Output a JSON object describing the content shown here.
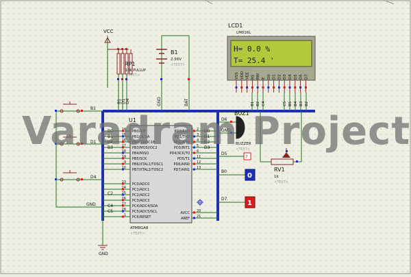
{
  "colors": {
    "bus": "#1f2fb0",
    "wire": "#1a7a1a",
    "component": "#8a2424",
    "chip_fill": "#d8d8d8",
    "lcd_screen": "#b4c83c",
    "watermark": "#6e6e6e",
    "pin_red": "#d81b1b",
    "pin_blue": "#1c2fd6"
  },
  "watermark": "Varadram Projects",
  "vcc": {
    "label": "VCC"
  },
  "gnd": {
    "label": "GND"
  },
  "resistor_pack": {
    "ref": "RP1",
    "value": "10K PULLUP",
    "text": "<TEXT>"
  },
  "battery": {
    "ref": "B1",
    "value": "2.56V",
    "text": "<TEXT>"
  },
  "lcd": {
    "ref": "LCD1",
    "model": "LM016L",
    "line1": "H= 0.0 %",
    "line2": "T= 25.4 '",
    "text": "<TEXT>",
    "pins": [
      "VSS",
      "VDD",
      "VEE",
      "RS",
      "RW",
      "E",
      "D0",
      "D1",
      "D2",
      "D3",
      "D4",
      "D5",
      "D6",
      "D7"
    ]
  },
  "mcu": {
    "ref": "U1",
    "model": "ATMEGA8",
    "text": "<TEXT>",
    "left_pins": [
      {
        "num": "14",
        "name": "PB0/ICP"
      },
      {
        "num": "15",
        "name": "PB1/OC1A"
      },
      {
        "num": "16",
        "name": "PB2/SS/OC1B"
      },
      {
        "num": "17",
        "name": "PB3/MOSI/OC2"
      },
      {
        "num": "18",
        "name": "PB4/MISO"
      },
      {
        "num": "19",
        "name": "PB5/SCK"
      },
      {
        "num": "9",
        "name": "PB6/XTAL1/TOSC1"
      },
      {
        "num": "10",
        "name": "PB7/XTAL2/TOSC2"
      },
      {
        "num": "23",
        "name": "PC0/ADC0"
      },
      {
        "num": "24",
        "name": "PC1/ADC1"
      },
      {
        "num": "25",
        "name": "PC2/ADC2"
      },
      {
        "num": "26",
        "name": "PC3/ADC3"
      },
      {
        "num": "27",
        "name": "PC4/ADC4/SDA"
      },
      {
        "num": "28",
        "name": "PC5/ADC5/SCL"
      },
      {
        "num": "1",
        "name": "PC6/RESET"
      }
    ],
    "right_pins": [
      {
        "num": "2",
        "name": "PD0/RXD"
      },
      {
        "num": "3",
        "name": "PD1/TXD"
      },
      {
        "num": "4",
        "name": "PD2/INT0"
      },
      {
        "num": "5",
        "name": "PD3/INT1"
      },
      {
        "num": "6",
        "name": "PD4/XCK/T0"
      },
      {
        "num": "11",
        "name": "PD5/T1"
      },
      {
        "num": "12",
        "name": "PD6/AIN0"
      },
      {
        "num": "13",
        "name": "PD7/AIN1"
      },
      {
        "num": "20",
        "name": "AVCC"
      },
      {
        "num": "21",
        "name": "AREF"
      }
    ]
  },
  "net_labels": {
    "mcu_left": [
      "B0",
      "B1",
      "B2",
      "B3"
    ],
    "mcu_left_c": [
      "C2",
      "C4",
      "C5"
    ],
    "mcu_right": [
      "D0",
      "D1",
      "D2",
      "D3"
    ],
    "lcd_bus": [
      "B1",
      "B2",
      "C4",
      "C5",
      "B5",
      "B4",
      "B3",
      "B2"
    ],
    "d6": "D6",
    "d5": "D5",
    "b0": "B0",
    "d7": "D7",
    "b1": "B1",
    "d1": "D1",
    "d4": "D4",
    "gnd": "GND",
    "bat": "BAT",
    "c1": "C1"
  },
  "buttons": [
    {
      "net": "B1"
    },
    {
      "net": "D1"
    },
    {
      "net": "D4"
    }
  ],
  "buzzer": {
    "ref": "BUZ1",
    "label": "BUZZER",
    "text": "<TEXT>"
  },
  "pot": {
    "ref": "RV1",
    "value": "1k",
    "text": "<TEXT>"
  },
  "logic_probes": [
    {
      "value": "0"
    },
    {
      "value": "1"
    }
  ],
  "logic_state": {
    "value": "?"
  }
}
